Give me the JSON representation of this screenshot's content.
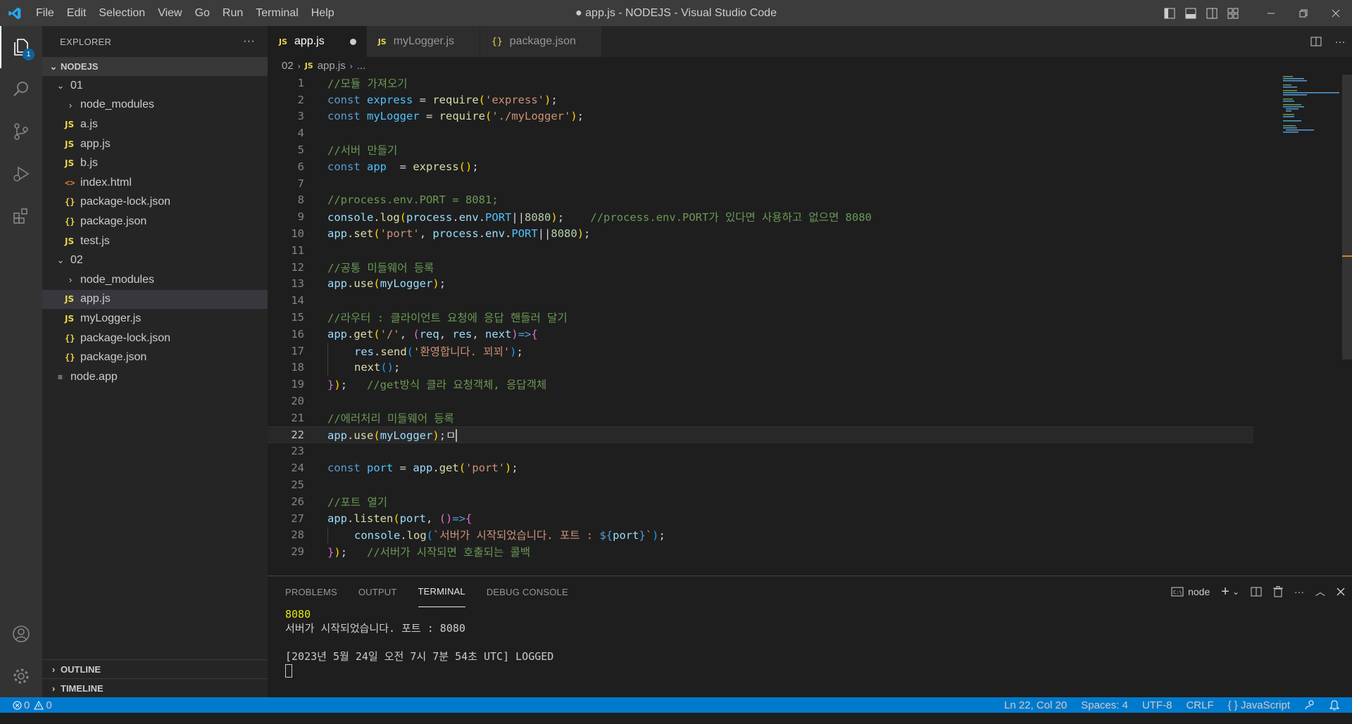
{
  "menu": [
    "File",
    "Edit",
    "Selection",
    "View",
    "Go",
    "Run",
    "Terminal",
    "Help"
  ],
  "window_title": "● app.js - NODEJS - Visual Studio Code",
  "activity": {
    "explorer_badge": "1"
  },
  "sidebar": {
    "header": "EXPLORER",
    "more": "···",
    "root": "NODEJS",
    "folder01": "01",
    "items01": [
      {
        "name": "node_modules",
        "type": "folder"
      },
      {
        "name": "a.js",
        "type": "js"
      },
      {
        "name": "app.js",
        "type": "js"
      },
      {
        "name": "b.js",
        "type": "js"
      },
      {
        "name": "index.html",
        "type": "html"
      },
      {
        "name": "package-lock.json",
        "type": "json"
      },
      {
        "name": "package.json",
        "type": "json"
      },
      {
        "name": "test.js",
        "type": "js"
      }
    ],
    "folder02": "02",
    "items02": [
      {
        "name": "node_modules",
        "type": "folder"
      },
      {
        "name": "app.js",
        "type": "js"
      },
      {
        "name": "myLogger.js",
        "type": "js"
      },
      {
        "name": "package-lock.json",
        "type": "json"
      },
      {
        "name": "package.json",
        "type": "json"
      }
    ],
    "root_file": "node.app",
    "outline": "OUTLINE",
    "timeline": "TIMELINE"
  },
  "tabs": [
    {
      "label": "app.js",
      "icon": "JS"
    },
    {
      "label": "myLogger.js",
      "icon": "JS"
    },
    {
      "label": "package.json",
      "icon": "{}"
    }
  ],
  "breadcrumb": {
    "folder": "02",
    "file": "app.js",
    "tail": "..."
  },
  "code": {
    "l1": "//모듈 가져오기",
    "l2_kw": "const",
    "l2_var": "express",
    "l2_op": " = ",
    "l2_fn": "require",
    "l2_str": "'express'",
    "l3_kw": "const",
    "l3_var": "myLogger",
    "l3_op": " = ",
    "l3_fn": "require",
    "l3_str": "'./myLogger'",
    "l5": "//서버 만들기",
    "l6_kw": "const",
    "l6_var": "app",
    "l6_op": "  = ",
    "l6_fn": "express",
    "l8": "//process.env.PORT = 8081;",
    "l9_a": "console",
    "l9_b": "log",
    "l9_c": "process",
    "l9_d": "env",
    "l9_e": "PORT",
    "l9_num": "8080",
    "l9_com": "//process.env.PORT가 있다면 사용하고 없으면 8080",
    "l10_a": "app",
    "l10_b": "set",
    "l10_str": "'port'",
    "l10_c": "process",
    "l10_d": "env",
    "l10_e": "PORT",
    "l10_num": "8080",
    "l12": "//공통 미들웨어 등록",
    "l13_a": "app",
    "l13_b": "use",
    "l13_c": "myLogger",
    "l15": "//라우터 : 클라이언트 요청에 응답 핸들러 달기",
    "l16_a": "app",
    "l16_b": "get",
    "l16_str": "'/'",
    "l16_p1": "req",
    "l16_p2": "res",
    "l16_p3": "next",
    "l17_a": "res",
    "l17_b": "send",
    "l17_str": "'환영합니다. 꾀꾀'",
    "l18_a": "next",
    "l19_com": "//get방식 클라 요청객체, 응답객체",
    "l21": "//에러처리 미들웨어 등록",
    "l22_a": "app",
    "l22_b": "use",
    "l22_c": "myLogger",
    "l22_box": "ㅁ",
    "l24_kw": "const",
    "l24_var": "port",
    "l24_a": "app",
    "l24_b": "get",
    "l24_str": "'port'",
    "l26": "//포트 열기",
    "l27_a": "app",
    "l27_b": "listen",
    "l27_c": "port",
    "l28_a": "console",
    "l28_b": "log",
    "l28_str1": "`서버가 시작되었습니다. 포트 : ",
    "l28_var": "port",
    "l28_str2": "`",
    "l29_com": "//서버가 시작되면 호출되는 콜백"
  },
  "panel": {
    "tabs": [
      "PROBLEMS",
      "OUTPUT",
      "TERMINAL",
      "DEBUG CONSOLE"
    ],
    "terminal_name": "node",
    "lines": [
      "8080",
      "서버가 시작되었습니다. 포트 : 8080",
      "",
      "[2023년 5월 24일 오전 7시 7분 54초 UTC] LOGGED"
    ]
  },
  "status": {
    "errors": "0",
    "warnings": "0",
    "position": "Ln 22, Col 20",
    "spaces": "Spaces: 4",
    "encoding": "UTF-8",
    "eol": "CRLF",
    "language": "{ } JavaScript"
  },
  "colors": {
    "accent": "#007acc",
    "js_icon": "#e8d44d",
    "html_icon": "#e37933"
  }
}
